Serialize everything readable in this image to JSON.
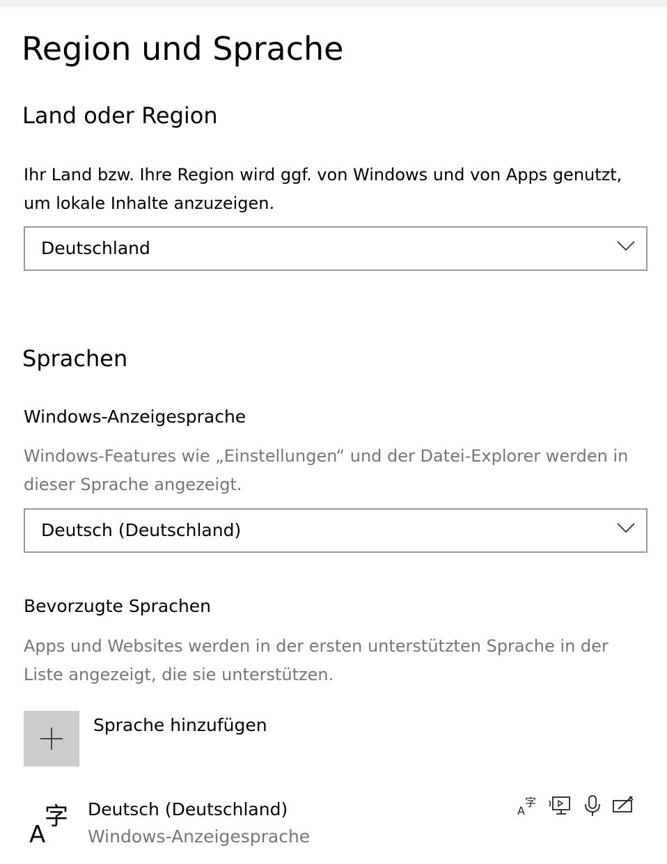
{
  "page": {
    "title": "Region und Sprache"
  },
  "region": {
    "heading": "Land oder Region",
    "description": "Ihr Land bzw. Ihre Region wird ggf. von Windows und von Apps genutzt, um lokale Inhalte anzuzeigen.",
    "selected": "Deutschland"
  },
  "languages": {
    "heading": "Sprachen",
    "display": {
      "heading": "Windows-Anzeigesprache",
      "description": "Windows-Features wie „Einstellungen“ und der Datei-Explorer werden in dieser Sprache angezeigt.",
      "selected": "Deutsch (Deutschland)"
    },
    "preferred": {
      "heading": "Bevorzugte Sprachen",
      "description": "Apps und Websites werden in der ersten unterstützten Sprache in der Liste angezeigt, die sie unterstützen.",
      "add_label": "Sprache hinzufügen",
      "items": [
        {
          "name": "Deutsch (Deutschland)",
          "subtitle": "Windows-Anzeigesprache",
          "icon": "language-icon",
          "features": [
            "display-language-icon",
            "text-to-speech-icon",
            "speech-recognition-icon",
            "handwriting-icon"
          ]
        }
      ]
    }
  },
  "colors": {
    "background": "#ffffff",
    "secondary_text": "#767676",
    "dropdown_border": "#999999",
    "add_tile": "#cccccc"
  }
}
